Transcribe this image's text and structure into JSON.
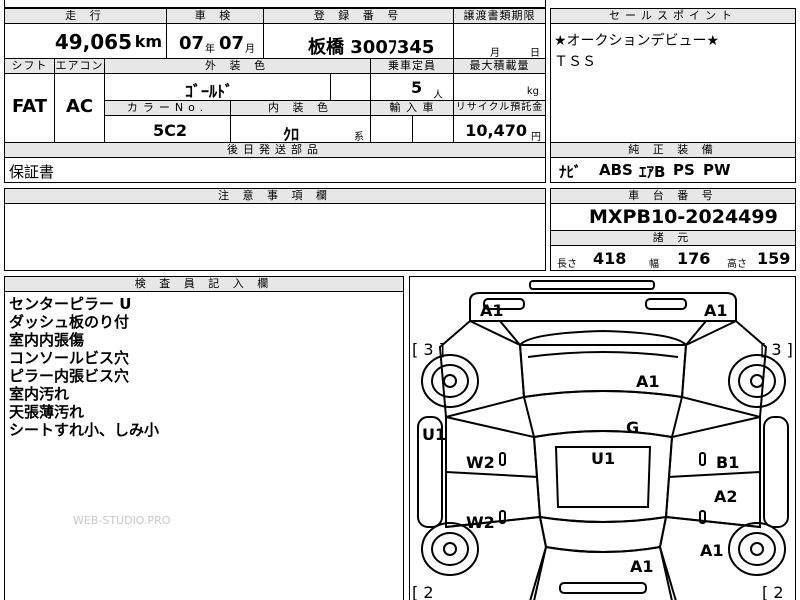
{
  "headers": {
    "mileage": "走 行",
    "inspection": "車 検",
    "reg_no": "登 録 番 号",
    "transfer_deadline": "譲渡書類期限",
    "sales_point": "セールスポイント",
    "shift": "シフト",
    "aircon": "エアコン",
    "ext_color": "外 装 色",
    "capacity": "乗車定員",
    "max_load": "最大積載量",
    "color_no": "カラーNo.",
    "int_color": "内 装 色",
    "import": "輸 入 車",
    "recycle": "リサイクル預託金",
    "later_parts": "後日発送部品",
    "genuine_equip": "純 正 装 備",
    "caution": "注 意 事 項 欄",
    "chassis_no": "車 台 番 号",
    "specs": "諸 元",
    "inspector_notes": "検 査 員 記 入 欄"
  },
  "values": {
    "mileage": "49,065",
    "mileage_unit": "km",
    "insp_year": "07",
    "insp_year_unit": "年",
    "insp_month": "07",
    "insp_month_unit": "月",
    "reg_no": "板橋 300ﾌ345",
    "deadline_month_unit": "月",
    "deadline_day_unit": "日",
    "shift": "FAT",
    "aircon": "AC",
    "ext_color": "ｺﾞｰﾙﾄﾞ",
    "capacity": "5",
    "capacity_unit": "人",
    "max_load_unit": "kg",
    "color_no": "5C2",
    "int_color": "ｸﾛ",
    "int_color_unit": "系",
    "recycle": "10,470",
    "recycle_unit": "円",
    "later_parts": "保証書",
    "chassis_no": "MXPB10-2024499"
  },
  "sales_point_lines": [
    "★オークションデビュー★",
    "ＴＳＳ"
  ],
  "genuine_equip_items": [
    "ﾅﾋﾞ",
    "ABS",
    "ｴｱB",
    "PS",
    "PW"
  ],
  "specs": {
    "length_label": "長さ",
    "length": "418",
    "width_label": "幅",
    "width": "176",
    "height_label": "高さ",
    "height": "159"
  },
  "inspector_notes": [
    "センターピラー U",
    "ダッシュ板のり付",
    "室内内張傷",
    "コンソールビス穴",
    "ピラー内張ビス穴",
    "室内汚れ",
    "天張薄汚れ",
    "シートすれ小、しみ小"
  ],
  "watermark": "WEB-STUDIO.PRO",
  "diagram_labels": {
    "front_left": "A1",
    "front_right": "A1",
    "left_tire_front": "[ 3 ]",
    "right_tire_front": "[ 3 ]",
    "hood": "A1",
    "left_side": "U1",
    "roof_glass": "G",
    "roof": "U1",
    "left_front_door": "W2",
    "right_front_door": "B1",
    "right_rear_door": "A2",
    "left_rear_door": "W2",
    "right_rear_quarter": "A1",
    "trunk": "A1",
    "left_tire_rear": "[ 2",
    "right_tire_rear": "[ 2"
  }
}
